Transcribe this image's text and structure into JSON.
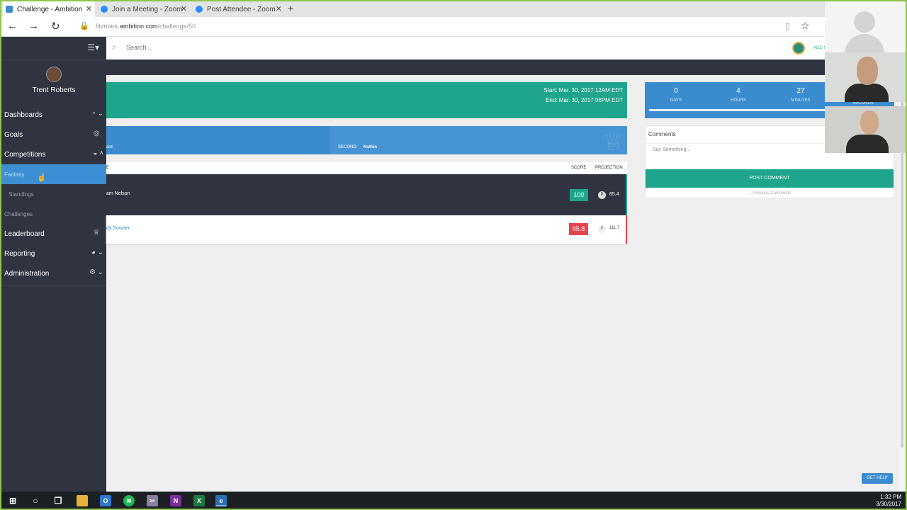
{
  "browser": {
    "tabs": [
      {
        "label": "Challenge - Ambition",
        "active": true,
        "icon": "ambition-icon"
      },
      {
        "label": "Join a Meeting - Zoom",
        "active": false,
        "icon": "zoom-icon"
      },
      {
        "label": "Post Attendee - Zoom",
        "active": false,
        "icon": "zoom-icon"
      }
    ],
    "new_tab": "+",
    "url_prefix": "fitzmark.",
    "url_domain": "ambition.com",
    "url_path": "/challenge/50"
  },
  "sidebar": {
    "user": "Trent Roberts",
    "items": [
      {
        "label": "Dashboards",
        "icon": "gauge-icon"
      },
      {
        "label": "Goals",
        "icon": "target-icon"
      },
      {
        "label": "Competitions",
        "icon": "helmet-icon"
      },
      {
        "label": "Fantasy"
      },
      {
        "label": "Standings"
      },
      {
        "label": "Challenges"
      },
      {
        "label": "Leaderboard",
        "icon": "trophy-icon"
      },
      {
        "label": "Reporting",
        "icon": "pie-icon"
      },
      {
        "label": "Administration",
        "icon": "gears-icon"
      }
    ]
  },
  "topbar": {
    "search_placeholder": "Search...",
    "add_progress": "ADD NEW PROGRESS"
  },
  "challenge": {
    "start": "Start: Mar. 30, 2017 12AM EDT",
    "end": "End: Mar. 30, 2017 06PM EDT",
    "first_fragment": "ard",
    "second_label": "SECOND:",
    "second_value": "Nuthin",
    "columns": {
      "name": "E",
      "score": "SCORE",
      "projection": "PROJECTION"
    },
    "rows": [
      {
        "name": "am Nelson",
        "score": "100",
        "projection": "85.4",
        "score_color": "#1ea58c"
      },
      {
        "name": "dy Sowder",
        "score": "95.8",
        "projection": "111.7",
        "score_color": "#e8444f"
      }
    ],
    "projection_badge": "P"
  },
  "countdown": {
    "days": {
      "value": "0",
      "label": "DAYS"
    },
    "hours": {
      "value": "4",
      "label": "HOURS"
    },
    "minutes": {
      "value": "27",
      "label": "MINUTES"
    },
    "seconds_label": "SECONDS"
  },
  "comments": {
    "title": "Comments",
    "placeholder": "Say Something...",
    "post_label": "POST COMMENT",
    "previous_label": "Previous Comments"
  },
  "help_label": "GET HELP",
  "taskbar": {
    "time": "1:32 PM",
    "date": "3/30/2017"
  },
  "colors": {
    "accent_green": "#1ea58c",
    "accent_blue": "#3b8ccf",
    "sidebar": "#2f3440",
    "danger": "#e8444f"
  }
}
